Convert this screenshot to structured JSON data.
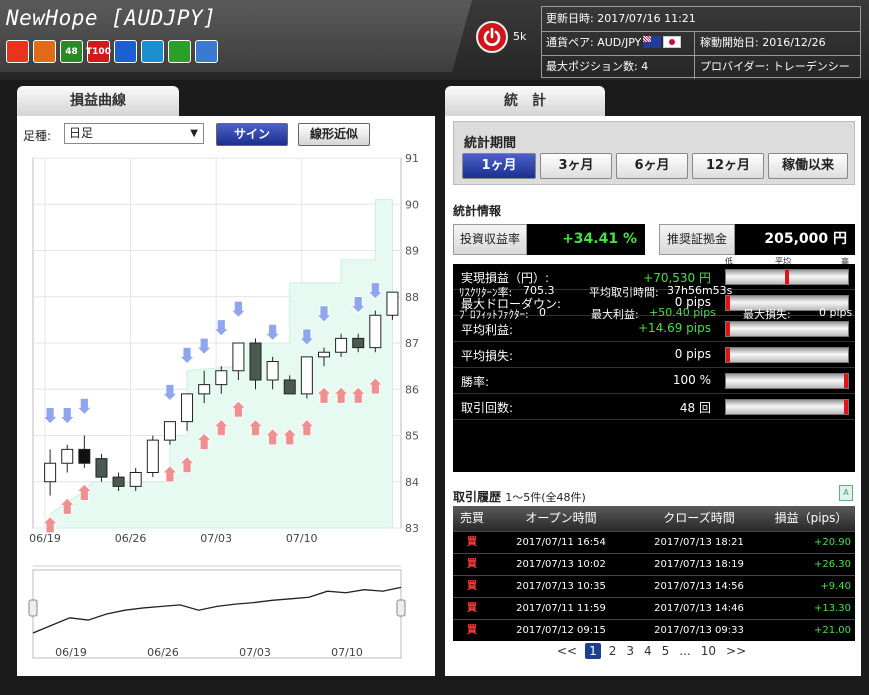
{
  "header": {
    "title": "NewHope [AUDJPY]",
    "follower_count": "5k",
    "badges": [
      {
        "icon": "smile-icon",
        "text": "",
        "color": "#e8341c"
      },
      {
        "icon": "rocket-icon",
        "text": "",
        "color": "#e06c1a"
      },
      {
        "icon": "48-badge",
        "text": "48",
        "color": "#2a8a2a"
      },
      {
        "icon": "t100-badge",
        "text": "T100",
        "color": "#d01a1a"
      },
      {
        "icon": "cross-arrows-icon",
        "text": "",
        "color": "#1c5fd0"
      },
      {
        "icon": "stairs-up-icon",
        "text": "",
        "color": "#1c8fd0"
      },
      {
        "icon": "clover-icon",
        "text": "",
        "color": "#2aa02a"
      },
      {
        "icon": "target-icon",
        "text": "",
        "color": "#3a7ad0"
      }
    ],
    "info": {
      "updated": "更新日時: 2017/07/16 11:21",
      "pair": "通貨ペア: AUD/JPY",
      "start": "稼動開始日: 2016/12/26",
      "max_positions": "最大ポジション数: 4",
      "provider": "プロバイダー: トレーデンシー"
    }
  },
  "left": {
    "tab": "損益曲線",
    "period_label": "足種:",
    "period_value": "日足",
    "sign_button": "サイン",
    "linear_button": "線形近似"
  },
  "right": {
    "tab": "統　計",
    "stats_period_label": "統計期間",
    "period_buttons": [
      "1ヶ月",
      "3ヶ月",
      "6ヶ月",
      "12ヶ月",
      "稼働以来"
    ],
    "stats_heading": "統計情報",
    "roi_label": "投資収益率",
    "roi_value": "+34.41 %",
    "margin_label": "推奨証拠金",
    "margin_value": "205,000 円",
    "gauge_legend": {
      "low": "低",
      "mid": "平均",
      "high": "高"
    },
    "metrics": [
      {
        "label": "実現損益（円）:",
        "value": "+70,530 円",
        "positive": true,
        "gauge": 0.5
      },
      {
        "label": "最大ドローダウン:",
        "value": "0 pips",
        "positive": false,
        "gauge": 0.0
      },
      {
        "label": "平均利益:",
        "value": "+14.69 pips",
        "positive": true,
        "gauge": 0.0
      },
      {
        "label": "平均損失:",
        "value": "0 pips",
        "positive": false,
        "gauge": 0.0
      },
      {
        "label": "勝率:",
        "value": "100 %",
        "positive": false,
        "gauge": 1.0
      },
      {
        "label": "取引回数:",
        "value": "48 回",
        "positive": false,
        "gauge": 1.0
      }
    ],
    "extra": {
      "recovery_label": "ﾘｽｸﾘﾀｰﾝ率:",
      "recovery_value": "705.3",
      "avg_hold_label": "平均取引時間:",
      "avg_hold_value": "37h56m53s",
      "pf_label": "ﾌﾟﾛﾌｨｯﾄﾌｧｸﾀｰ:",
      "pf_value": "0",
      "max_profit_label": "最大利益:",
      "max_profit_value": "+50.40 pips",
      "max_loss_label": "最大損失:",
      "max_loss_value": "0 pips"
    },
    "history_heading": "取引履歴",
    "history_count": "1～5件(全48件)",
    "history_columns": [
      "売買",
      "オープン時間",
      "クローズ時間",
      "損益（pips）"
    ],
    "history_rows": [
      {
        "side": "買",
        "open": "2017/07/11 16:54",
        "close": "2017/07/13 18:21",
        "pnl": "+20.90"
      },
      {
        "side": "買",
        "open": "2017/07/13 10:02",
        "close": "2017/07/13 18:19",
        "pnl": "+26.30"
      },
      {
        "side": "買",
        "open": "2017/07/13 10:35",
        "close": "2017/07/13 14:56",
        "pnl": "+9.40"
      },
      {
        "side": "買",
        "open": "2017/07/11 11:59",
        "close": "2017/07/13 14:46",
        "pnl": "+13.30"
      },
      {
        "side": "買",
        "open": "2017/07/12 09:15",
        "close": "2017/07/13 09:33",
        "pnl": "+21.00"
      }
    ],
    "pager": [
      "<<",
      "1",
      "2",
      "3",
      "4",
      "5",
      "...",
      "10",
      ">>"
    ],
    "pager_current": "1"
  },
  "chart_data": {
    "type": "candlestick",
    "x_ticks": [
      "06/19",
      "06/26",
      "07/03",
      "07/10"
    ],
    "y_ticks": [
      83,
      84,
      85,
      86,
      87,
      88,
      89,
      90,
      91
    ],
    "ylim": [
      83,
      91
    ],
    "candles": [
      {
        "o": 84.0,
        "h": 84.7,
        "l": 83.7,
        "c": 84.4
      },
      {
        "o": 84.4,
        "h": 84.8,
        "l": 84.2,
        "c": 84.7
      },
      {
        "o": 84.7,
        "h": 85.0,
        "l": 84.3,
        "c": 84.4
      },
      {
        "o": 84.5,
        "h": 84.6,
        "l": 84.0,
        "c": 84.1
      },
      {
        "o": 84.1,
        "h": 84.2,
        "l": 83.8,
        "c": 83.9
      },
      {
        "o": 83.9,
        "h": 84.3,
        "l": 83.8,
        "c": 84.2
      },
      {
        "o": 84.2,
        "h": 85.0,
        "l": 84.1,
        "c": 84.9
      },
      {
        "o": 84.9,
        "h": 85.3,
        "l": 84.8,
        "c": 85.3
      },
      {
        "o": 85.3,
        "h": 85.9,
        "l": 85.1,
        "c": 85.9
      },
      {
        "o": 85.9,
        "h": 86.4,
        "l": 85.7,
        "c": 86.1
      },
      {
        "o": 86.1,
        "h": 86.5,
        "l": 85.9,
        "c": 86.4
      },
      {
        "o": 86.4,
        "h": 87.0,
        "l": 86.2,
        "c": 87.0
      },
      {
        "o": 87.0,
        "h": 87.1,
        "l": 86.0,
        "c": 86.2
      },
      {
        "o": 86.2,
        "h": 86.7,
        "l": 86.0,
        "c": 86.6
      },
      {
        "o": 86.2,
        "h": 86.3,
        "l": 85.9,
        "c": 85.9
      },
      {
        "o": 85.9,
        "h": 86.7,
        "l": 85.8,
        "c": 86.7
      },
      {
        "o": 86.7,
        "h": 86.9,
        "l": 86.5,
        "c": 86.8
      },
      {
        "o": 86.8,
        "h": 87.2,
        "l": 86.7,
        "c": 87.1
      },
      {
        "o": 87.1,
        "h": 87.2,
        "l": 86.8,
        "c": 86.9
      },
      {
        "o": 86.9,
        "h": 87.7,
        "l": 86.8,
        "c": 87.6
      },
      {
        "o": 87.6,
        "h": 88.1,
        "l": 87.5,
        "c": 88.1
      }
    ],
    "profit_band": [
      {
        "x": 0,
        "y": 83.3
      },
      {
        "x": 2,
        "y": 83.8
      },
      {
        "x": 2.5,
        "y": 84.0
      },
      {
        "x": 7,
        "y": 84.0
      },
      {
        "x": 7,
        "y": 85.0
      },
      {
        "x": 8,
        "y": 85.0
      },
      {
        "x": 8,
        "y": 86.4
      },
      {
        "x": 11,
        "y": 86.5
      },
      {
        "x": 11,
        "y": 87.0
      },
      {
        "x": 14,
        "y": 87.0
      },
      {
        "x": 14,
        "y": 88.3
      },
      {
        "x": 17,
        "y": 88.3
      },
      {
        "x": 17,
        "y": 88.8
      },
      {
        "x": 19,
        "y": 88.8
      },
      {
        "x": 19,
        "y": 90.1
      },
      {
        "x": 20,
        "y": 90.1
      }
    ],
    "sell_signals": [
      {
        "x": 0,
        "y": 85.3
      },
      {
        "x": 1,
        "y": 85.3
      },
      {
        "x": 2,
        "y": 85.5
      },
      {
        "x": 7,
        "y": 85.8
      },
      {
        "x": 8,
        "y": 86.6
      },
      {
        "x": 9,
        "y": 86.8
      },
      {
        "x": 10,
        "y": 87.2
      },
      {
        "x": 11,
        "y": 87.6
      },
      {
        "x": 13,
        "y": 87.1
      },
      {
        "x": 15,
        "y": 87.0
      },
      {
        "x": 16,
        "y": 87.5
      },
      {
        "x": 18,
        "y": 87.7
      },
      {
        "x": 19,
        "y": 88.0
      }
    ],
    "buy_signals": [
      {
        "x": 0,
        "y": 83.2
      },
      {
        "x": 1,
        "y": 83.6
      },
      {
        "x": 2,
        "y": 83.9
      },
      {
        "x": 7,
        "y": 84.3
      },
      {
        "x": 8,
        "y": 84.5
      },
      {
        "x": 9,
        "y": 85.0
      },
      {
        "x": 10,
        "y": 85.3
      },
      {
        "x": 11,
        "y": 85.7
      },
      {
        "x": 12,
        "y": 85.3
      },
      {
        "x": 13,
        "y": 85.1
      },
      {
        "x": 14,
        "y": 85.1
      },
      {
        "x": 15,
        "y": 85.3
      },
      {
        "x": 16,
        "y": 86.0
      },
      {
        "x": 17,
        "y": 86.0
      },
      {
        "x": 18,
        "y": 86.0
      },
      {
        "x": 19,
        "y": 86.2
      }
    ],
    "navigator_line": [
      0.25,
      0.35,
      0.45,
      0.42,
      0.5,
      0.55,
      0.58,
      0.6,
      0.62,
      0.55,
      0.6,
      0.63,
      0.65,
      0.68,
      0.7,
      0.72,
      0.8,
      0.78,
      0.82,
      0.8,
      0.85
    ],
    "navigator_ticks": [
      "06/19",
      "06/26",
      "07/03",
      "07/10"
    ]
  }
}
